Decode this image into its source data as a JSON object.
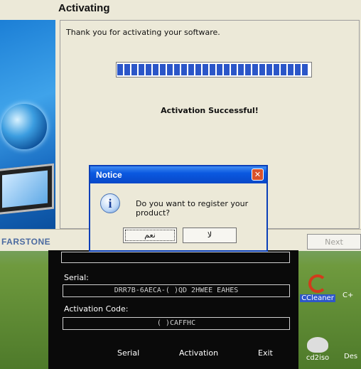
{
  "wizard": {
    "title": "Activating",
    "message": "Thank you for activating your software.",
    "progress_percent": 100,
    "status": "Activation Successful!",
    "brand": "FARSTONE",
    "next_label": "Next"
  },
  "notice": {
    "title": "Notice",
    "close_symbol": "✕",
    "info_symbol": "i",
    "message": "Do you want to register your product?",
    "yes_label": "نعم",
    "no_label": "لا"
  },
  "registration": {
    "serial_label": "Serial:",
    "serial_value": "DRR7B-6AECA-(              )QD 2HWEE EAHES",
    "activation_label": "Activation Code:",
    "activation_value": "(            )CAFFHC",
    "links": {
      "serial": "Serial",
      "activation": "Activation",
      "exit": "Exit"
    }
  },
  "desktop_icons": [
    {
      "label": "CCleaner",
      "icon": "ccleaner-icon"
    },
    {
      "label": "cd2iso",
      "icon": "cd2iso-icon"
    },
    {
      "label": "C+",
      "icon": "app-icon"
    },
    {
      "label": "Des",
      "icon": "desktop-icon"
    }
  ],
  "colors": {
    "title_bar": "#0a58e0",
    "progress": "#2b56c8",
    "panel_bg": "#ece9d8"
  }
}
